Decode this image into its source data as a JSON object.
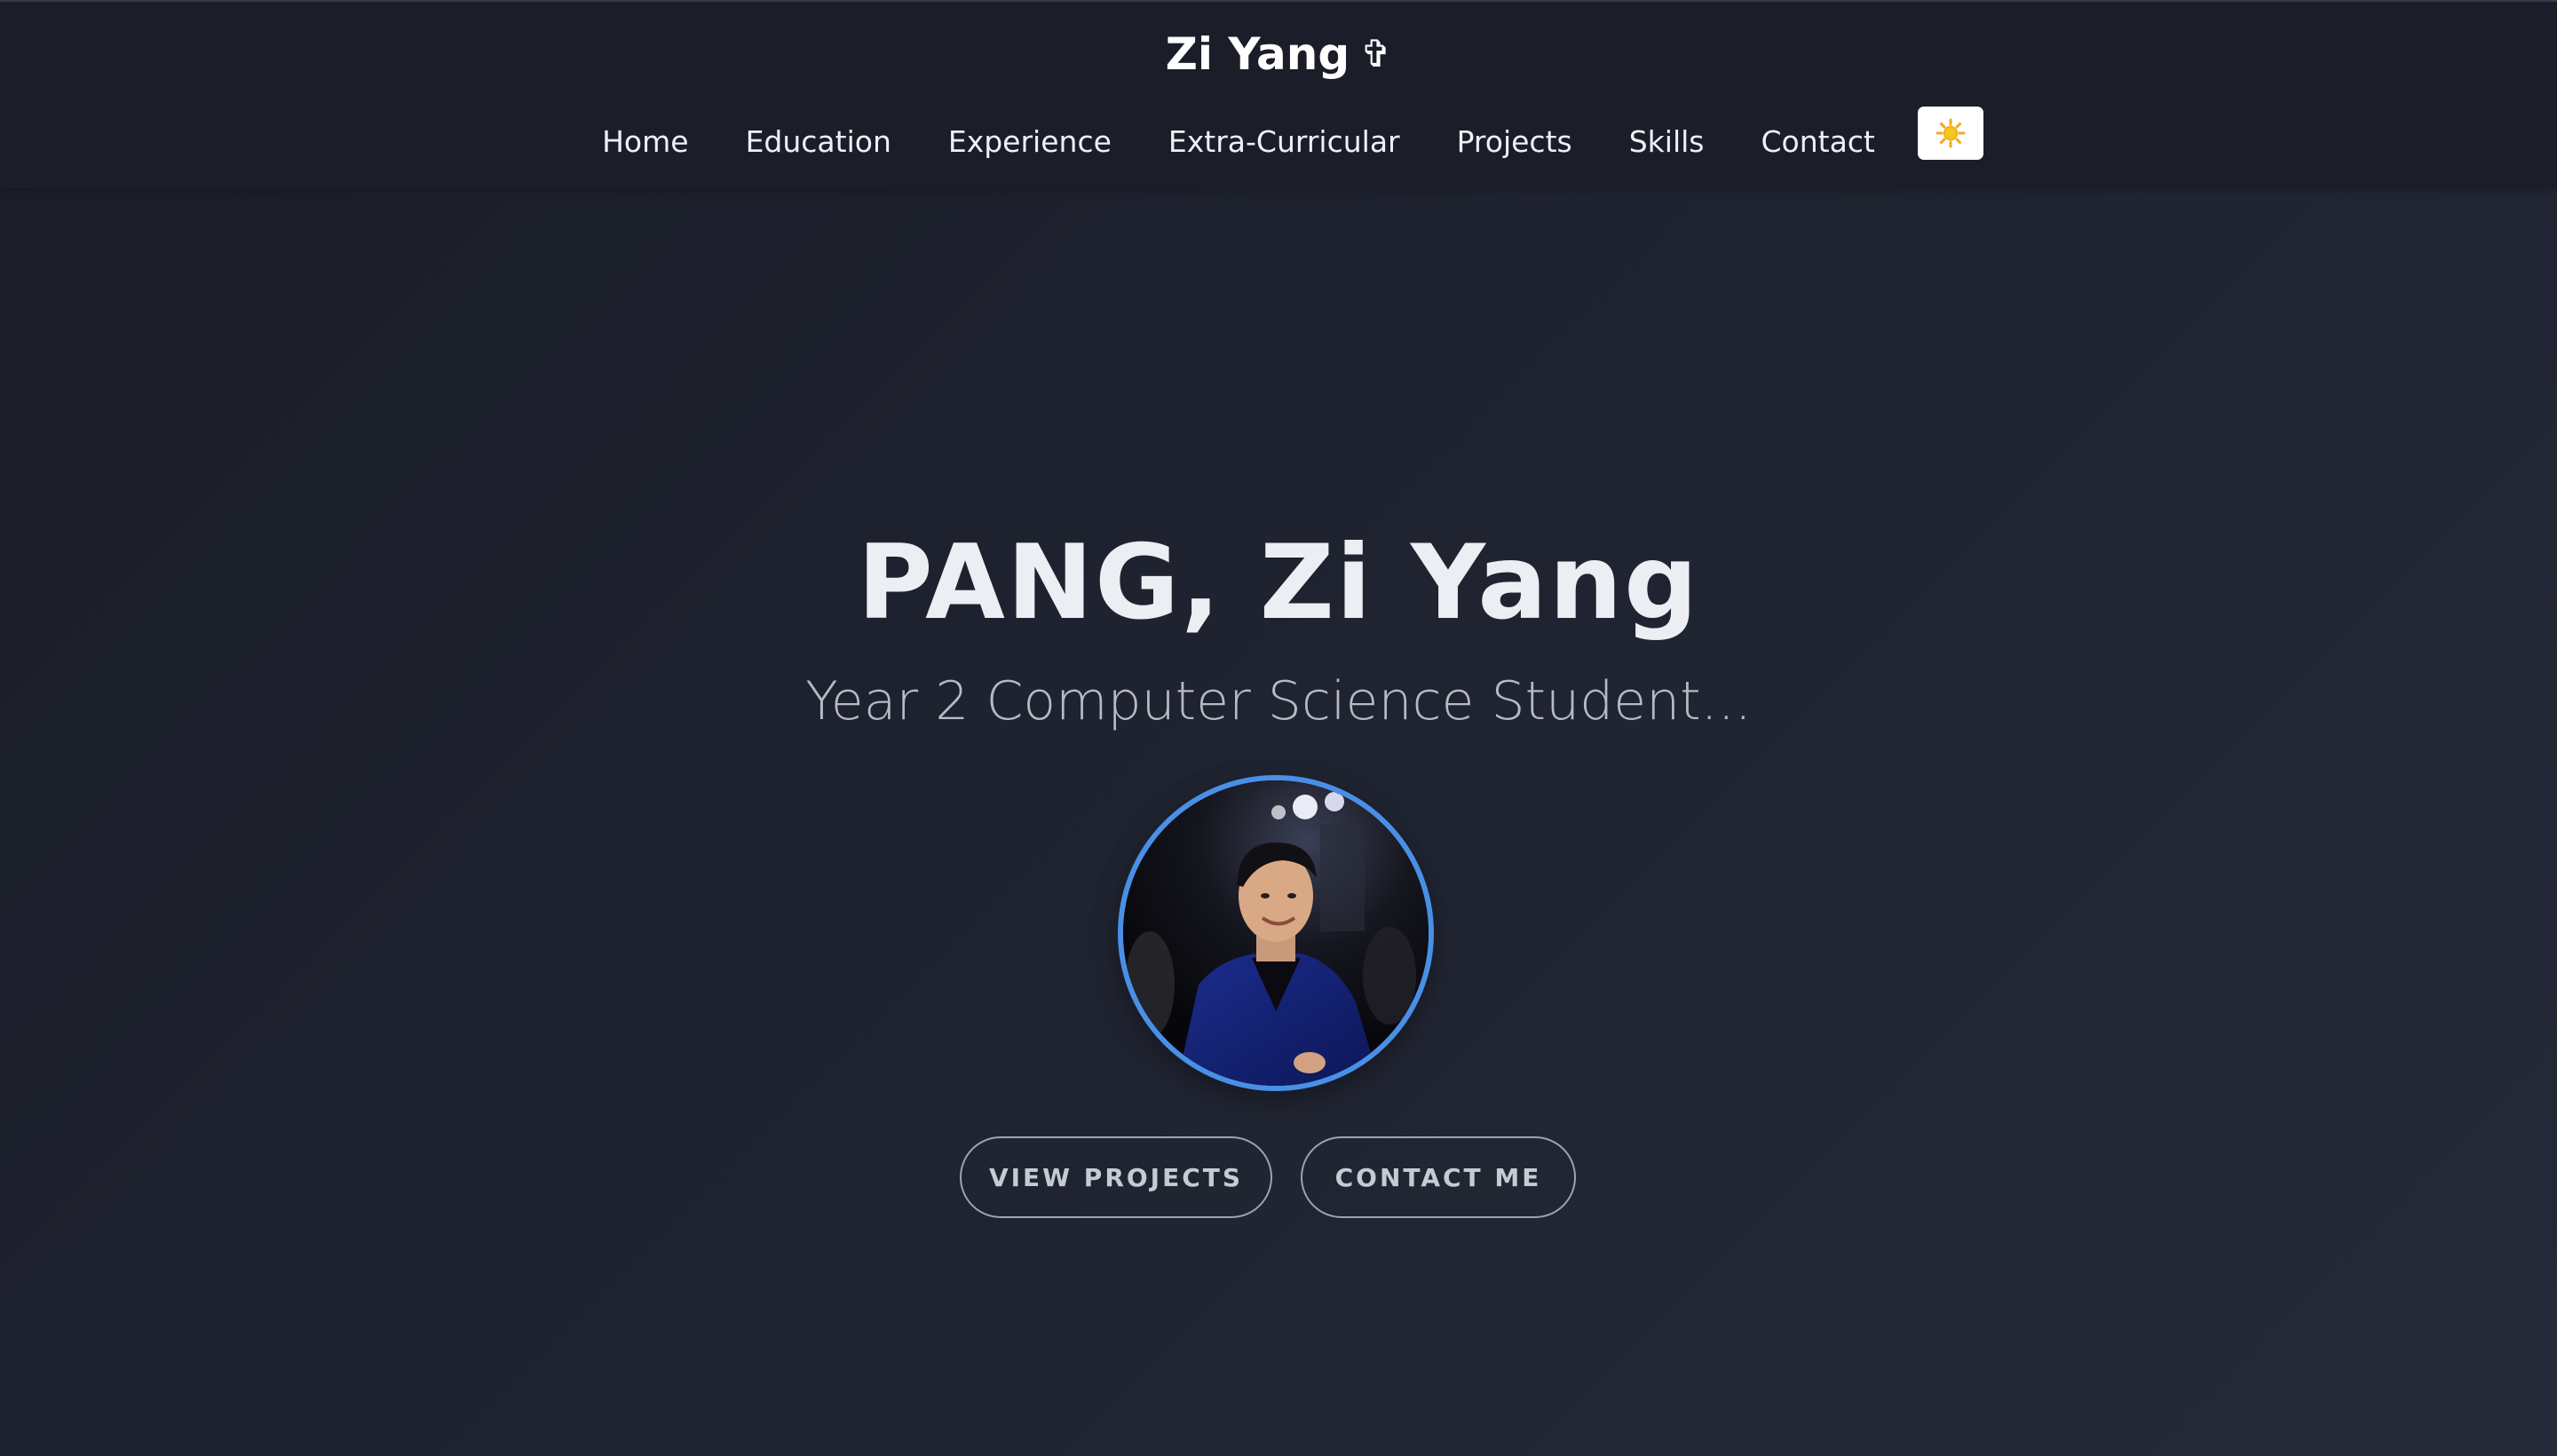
{
  "header": {
    "brand": "Zi Yang",
    "brand_symbol": "✞",
    "nav": [
      {
        "label": "Home"
      },
      {
        "label": "Education"
      },
      {
        "label": "Experience"
      },
      {
        "label": "Extra-Curricular"
      },
      {
        "label": "Projects"
      },
      {
        "label": "Skills"
      },
      {
        "label": "Contact"
      }
    ],
    "theme_toggle_icon": "sun-icon"
  },
  "hero": {
    "title": "PANG, Zi Yang",
    "subtitle": "Year 2 Computer Science Student...",
    "avatar": "profile-photo",
    "buttons": {
      "projects": "VIEW PROJECTS",
      "contact": "CONTACT ME"
    }
  },
  "colors": {
    "background": "#1f2330",
    "header": "#1b1e28",
    "accent": "#4a8fe6",
    "title_text": "#eceef3",
    "subtitle_text": "#b6bac6",
    "button_border": "#9ea3b0"
  }
}
